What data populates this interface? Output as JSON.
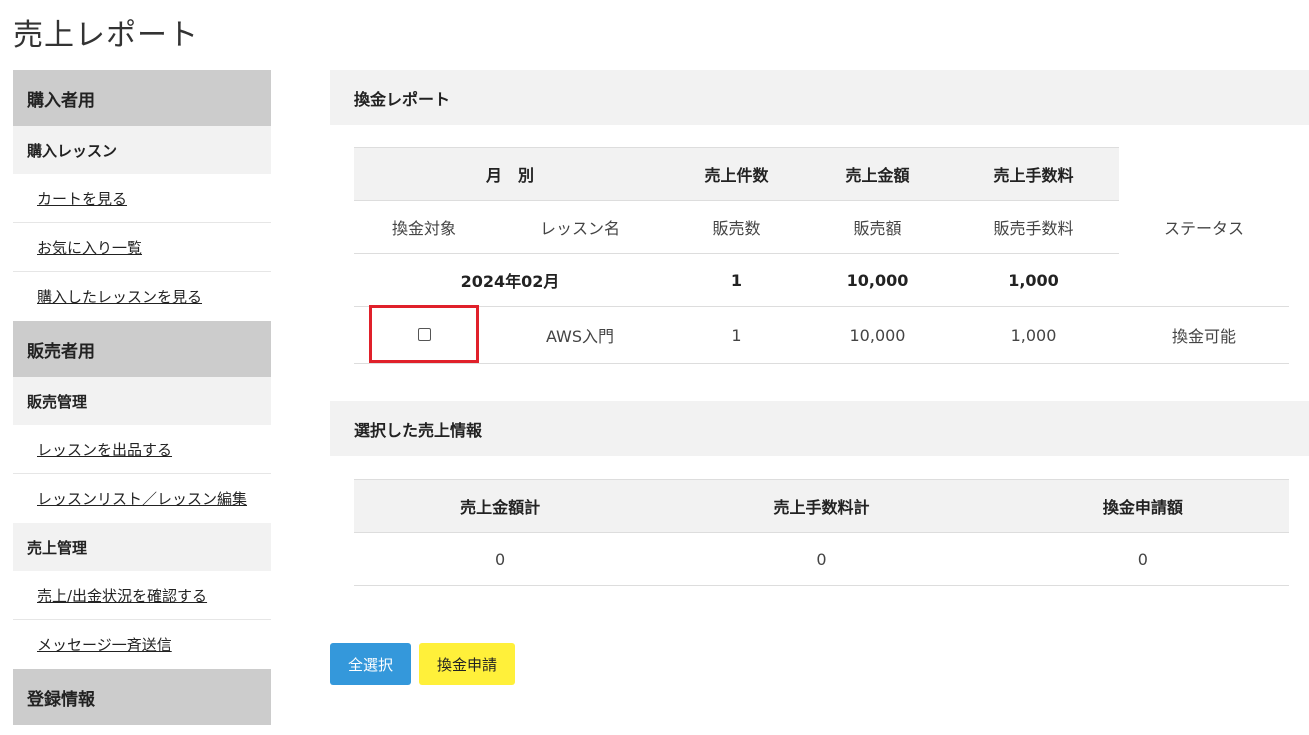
{
  "page": {
    "title": "売上レポート"
  },
  "sidebar": {
    "buyer": {
      "head": "購入者用",
      "sub": "購入レッスン",
      "links": [
        "カートを見る",
        "お気に入り一覧",
        "購入したレッスンを見る"
      ]
    },
    "seller": {
      "head": "販売者用",
      "sales_mgmt": "販売管理",
      "sales_links": [
        "レッスンを出品する",
        "レッスンリスト／レッスン編集"
      ],
      "revenue_mgmt": "売上管理",
      "revenue_links": [
        "売上/出金状況を確認する",
        "メッセージ一斉送信"
      ]
    },
    "registration": {
      "head": "登録情報"
    }
  },
  "report": {
    "heading": "換金レポート",
    "header1": [
      "月　別",
      "売上件数",
      "売上金額",
      "売上手数料"
    ],
    "header2": [
      "換金対象",
      "レッスン名",
      "販売数",
      "販売額",
      "販売手数料",
      "ステータス"
    ],
    "month_row": {
      "month": "2024年02月",
      "count": "1",
      "amount": "10,000",
      "fee": "1,000"
    },
    "items": [
      {
        "checked": false,
        "lesson": "AWS入門",
        "qty": "1",
        "amount": "10,000",
        "fee": "1,000",
        "status": "換金可能"
      }
    ]
  },
  "selected": {
    "heading": "選択した売上情報",
    "headers": [
      "売上金額計",
      "売上手数料計",
      "換金申請額"
    ],
    "values": [
      "0",
      "0",
      "0"
    ]
  },
  "buttons": {
    "select_all": "全選択",
    "apply": "換金申請"
  },
  "colors": {
    "highlight": "#e0202a",
    "select_all_bg": "#3498db",
    "apply_bg": "#fff03a"
  }
}
